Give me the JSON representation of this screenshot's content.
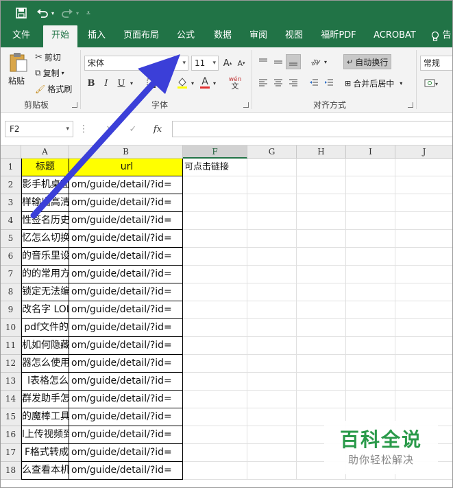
{
  "tabs": [
    "文件",
    "开始",
    "插入",
    "页面布局",
    "公式",
    "数据",
    "审阅",
    "视图",
    "福昕PDF",
    "ACROBAT"
  ],
  "active_tab": "开始",
  "ribbon": {
    "clipboard": {
      "paste": "粘贴",
      "cut": "剪切",
      "copy": "复制",
      "format_painter": "格式刷",
      "label": "剪贴板"
    },
    "font": {
      "name": "宋体",
      "size": "11",
      "label": "字体",
      "bold": "B",
      "italic": "I",
      "underline": "U",
      "font_color_glyph": "A",
      "phonetic": "wén"
    },
    "alignment": {
      "wrap_text": "自动换行",
      "merge_center": "合并后居中",
      "label": "对齐方式"
    },
    "number": {
      "format": "常规"
    }
  },
  "formula_bar": {
    "name_box": "F2",
    "fx": "fx",
    "value": ""
  },
  "columns": [
    "A",
    "B",
    "F",
    "G",
    "H",
    "I",
    "J"
  ],
  "selected_column": "F",
  "rows": [
    {
      "num": "1",
      "a": "标题",
      "b": "url",
      "f": "可点击链接"
    },
    {
      "num": "2",
      "a": "影手机桌面",
      "b": "om/guide/detail/?id=",
      "f": ""
    },
    {
      "num": "3",
      "a": "样输出高清",
      "b": "om/guide/detail/?id=",
      "f": ""
    },
    {
      "num": "4",
      "a": "性签名历史",
      "b": "om/guide/detail/?id=",
      "f": ""
    },
    {
      "num": "5",
      "a": "忆怎么切换",
      "b": "om/guide/detail/?id=",
      "f": ""
    },
    {
      "num": "6",
      "a": "的音乐里设",
      "b": "om/guide/detail/?id=",
      "f": ""
    },
    {
      "num": "7",
      "a": "的的常用方",
      "b": "om/guide/detail/?id=",
      "f": ""
    },
    {
      "num": "8",
      "a": "锁定无法编",
      "b": "om/guide/detail/?id=",
      "f": ""
    },
    {
      "num": "9",
      "a": "改名字 LOL",
      "b": "om/guide/detail/?id=",
      "f": ""
    },
    {
      "num": "10",
      "a": "pdf文件的",
      "b": "om/guide/detail/?id=",
      "f": ""
    },
    {
      "num": "11",
      "a": "机如何隐藏",
      "b": "om/guide/detail/?id=",
      "f": ""
    },
    {
      "num": "12",
      "a": "器怎么使用",
      "b": "om/guide/detail/?id=",
      "f": ""
    },
    {
      "num": "13",
      "a": "l表格怎么",
      "b": "om/guide/detail/?id=",
      "f": ""
    },
    {
      "num": "14",
      "a": "群发助手怎",
      "b": "om/guide/detail/?id=",
      "f": ""
    },
    {
      "num": "15",
      "a": "的魔棒工具",
      "b": "om/guide/detail/?id=",
      "f": ""
    },
    {
      "num": "16",
      "a": "l上传视频到",
      "b": "om/guide/detail/?id=",
      "f": ""
    },
    {
      "num": "17",
      "a": "F格式转成",
      "b": "om/guide/detail/?id=",
      "f": ""
    },
    {
      "num": "18",
      "a": "么查看本机",
      "b": "om/guide/detail/?id=",
      "f": ""
    }
  ],
  "watermark": {
    "title": "百科全说",
    "subtitle": "助你轻松解决"
  },
  "colors": {
    "excel_green": "#217346",
    "header_fill": "#ffff00",
    "arrow": "#3b3fd8"
  }
}
